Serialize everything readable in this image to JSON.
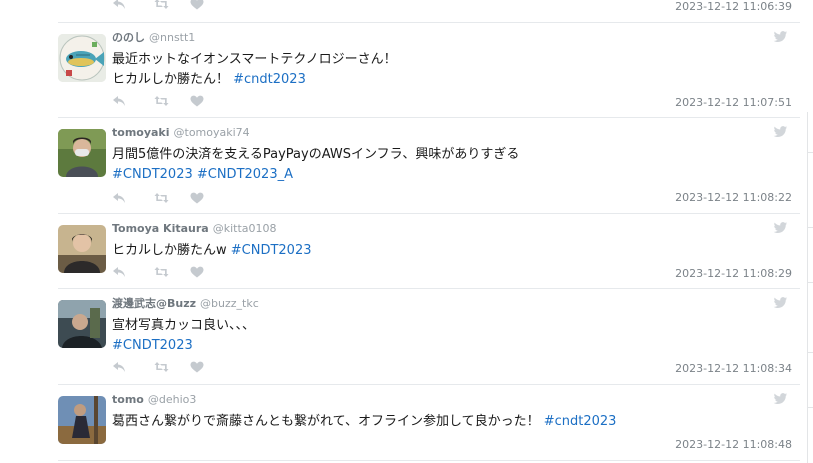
{
  "top_row": {
    "timestamp": "2023-12-12 11:06:39"
  },
  "tweets": [
    {
      "name": "ののし",
      "handle": "@nnstt1",
      "lines": [
        [
          "最近ホットなイオンスマートテクノロジーさん！"
        ],
        [
          "ヒカルしか勝たん！ ",
          "#cndt2023"
        ]
      ],
      "timestamp": "2023-12-12 11:07:51",
      "avatar": "fish-illustration"
    },
    {
      "name": "tomoyaki",
      "handle": "@tomoyaki74",
      "lines": [
        [
          "月間5億件の決済を支えるPayPayのAWSインフラ、興味がありすぎる"
        ],
        [
          "",
          "#CNDT2023 #CNDT2023_A"
        ]
      ],
      "timestamp": "2023-12-12 11:08:22",
      "avatar": "person-photo"
    },
    {
      "name": "Tomoya Kitaura",
      "handle": "@kitta0108",
      "lines": [
        [
          "ヒカルしか勝たんw ",
          "#CNDT2023"
        ]
      ],
      "timestamp": "2023-12-12 11:08:29",
      "avatar": "person-photo"
    },
    {
      "name": "渡邊武志@Buzz",
      "handle": "@buzz_tkc",
      "lines": [
        [
          "宣材写真カッコ良い、、、"
        ],
        [
          " ",
          "#CNDT2023"
        ]
      ],
      "timestamp": "2023-12-12 11:08:34",
      "avatar": "person-photo"
    },
    {
      "name": "tomo",
      "handle": "@dehio3",
      "lines": [
        [
          "葛西さん繋がりで斎藤さんとも繋がれて、オフライン参加して良かった！ ",
          "#cndt2023"
        ]
      ],
      "timestamp": "2023-12-12 11:08:48",
      "avatar": "person-photo"
    }
  ],
  "icons": {
    "reply": "reply-icon",
    "retweet": "retweet-icon",
    "like": "heart-icon",
    "source": "twitter-bird-icon"
  },
  "colors": {
    "hashtag": "#1c6fc4",
    "icon": "#c5cacf",
    "divider": "#e6e9ec"
  }
}
